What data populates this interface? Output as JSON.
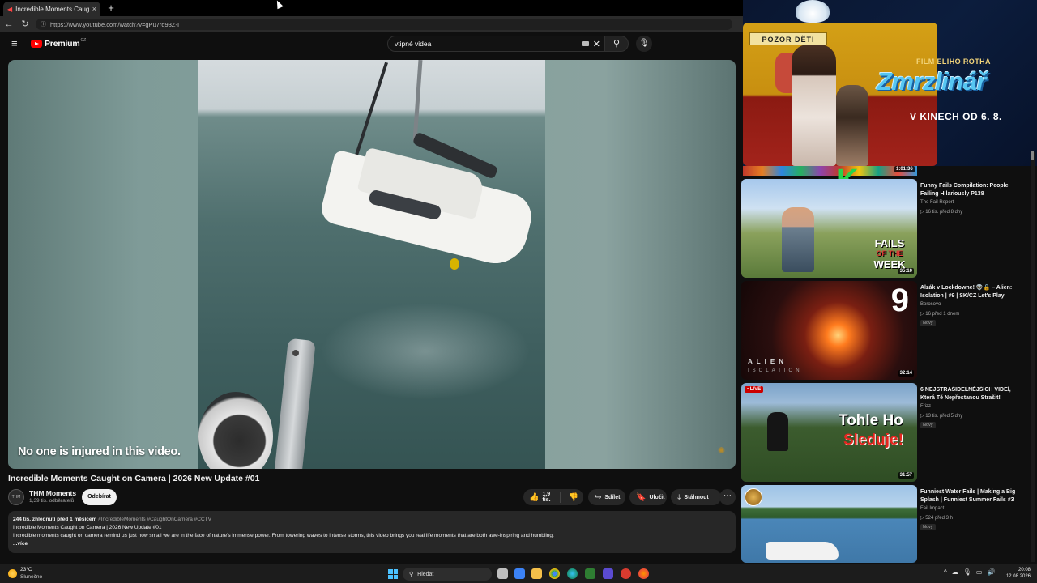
{
  "browser": {
    "tab_title": "Incredible Moments Caught o",
    "tab_close": "×",
    "new_tab": "+",
    "url": "https://www.youtube.com/watch?v=gPu7rq93Z-I",
    "back": "←",
    "reload": "↻",
    "lock": "ⓘ"
  },
  "masthead": {
    "menu": "≡",
    "logo_text": "Premium",
    "logo_cc": "CZ",
    "search_value": "vtipné videa",
    "clear": "✕",
    "search_btn": "⚲",
    "mic": "🎙"
  },
  "player": {
    "overlay_text": "No one is injured in this video.",
    "watermark": "✺"
  },
  "video": {
    "title": "Incredible Moments Caught on Camera | 2026 New Update #01",
    "channel_avatar": "THM",
    "channel_name": "THM Moments",
    "channel_subs": "1,39 tis. odběratelů",
    "subscribe_label": "Odebírat",
    "likes": "1,9 tis.",
    "like_icon": "👍",
    "dislike_icon": "👎",
    "share_label": "Sdílet",
    "share_icon": "↪",
    "save_label": "Uložit",
    "save_icon": "🔖",
    "download_label": "Stáhnout",
    "download_icon": "⤓",
    "more_icon": "⋯"
  },
  "description": {
    "meta": "244 tis. zhlédnutí  před 1 měsícem",
    "tags": "#IncredibleMoments #CaughtOnCamera #CCTV",
    "line1": "Incredible Moments Caught on Camera | 2026 New Update #01",
    "line2": "Incredible moments caught on camera remind us just how small we are in the face of nature's immense power. From towering waves to intense storms, this video brings you real life moments that are both awe-inspiring and humbling.",
    "more": "...více"
  },
  "ad": {
    "sign": "POZOR DĚTI",
    "film": "FILM ELIHO ROTHA",
    "title": "Zmrzlinář",
    "date": "V KINECH OD 6. 8."
  },
  "related_top": {
    "duration": "1:01:36"
  },
  "related": [
    {
      "title": "Funny Fails Compilation: People Failing Hilariously P138",
      "channel": "The Fail Report",
      "stats": "▷ 16 tis.  před 8 dny",
      "duration": "35:10",
      "badge": "",
      "live": "",
      "thumb_text1": "FAILS",
      "thumb_text2": "OF THE",
      "thumb_text3": "WEEK"
    },
    {
      "title": "Alzák v Lockdowne! 👽🔒 – Alien: Isolation | #9 | SK/CZ Let's Play",
      "channel": "Borosovo",
      "stats": "▷ 16  před 1 dnem",
      "duration": "32:14",
      "badge": "Nový",
      "live": "",
      "thumb_text1": "9",
      "thumb_text2": "ALIEN",
      "thumb_text3": "ISOLATION"
    },
    {
      "title": "6 NEJSTRAŠIDELNĚJŠÍCH VIDEÍ, Která Tě Nepřestanou Strašit!",
      "channel": "Frizz",
      "stats": "▷ 13 tis.  před 5 dny",
      "duration": "31:57",
      "badge": "Nový",
      "live": "• LIVE",
      "thumb_text1": "Tohle Ho",
      "thumb_text2": "Sleduje!",
      "thumb_text3": ""
    },
    {
      "title": "Funniest Water Fails | Making a Big Splash | Funniest Summer Fails #3",
      "channel": "Fail Impact",
      "stats": "▷ 524  před 3 h",
      "duration": "",
      "badge": "Nový",
      "live": "",
      "thumb_text1": "",
      "thumb_text2": "",
      "thumb_text3": ""
    }
  ],
  "taskbar": {
    "temp": "23°C",
    "weather": "Slunečno",
    "search": "Hledat",
    "search_icon": "⚲",
    "time": "20:08",
    "date": "12.08.2026",
    "tray_chevron": "^",
    "tray_icons": [
      "☁",
      "🎙",
      "▭",
      "🔊"
    ]
  },
  "colors": {
    "youtube_red": "#ff0000",
    "background": "#0f0f0f",
    "pill": "#272727",
    "accent_blue": "#4cc2ff"
  }
}
